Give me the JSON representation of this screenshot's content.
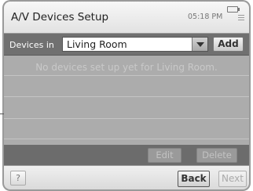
{
  "window": {
    "title": "A/V Devices Setup",
    "time": "05:18 PM"
  },
  "status_icons": [
    "battery-icon",
    "menu-icon"
  ],
  "location_row": {
    "label": "Devices in",
    "selected_room": "Living Room",
    "dropdown_icon": "chevron-down-icon",
    "add_label": "Add"
  },
  "device_list": {
    "empty_message": "No devices set up yet for Living Room.",
    "items": []
  },
  "actions": {
    "edit_label": "Edit",
    "delete_label": "Delete"
  },
  "footer": {
    "help_label": "?",
    "back_label": "Back",
    "next_label": "Next"
  }
}
